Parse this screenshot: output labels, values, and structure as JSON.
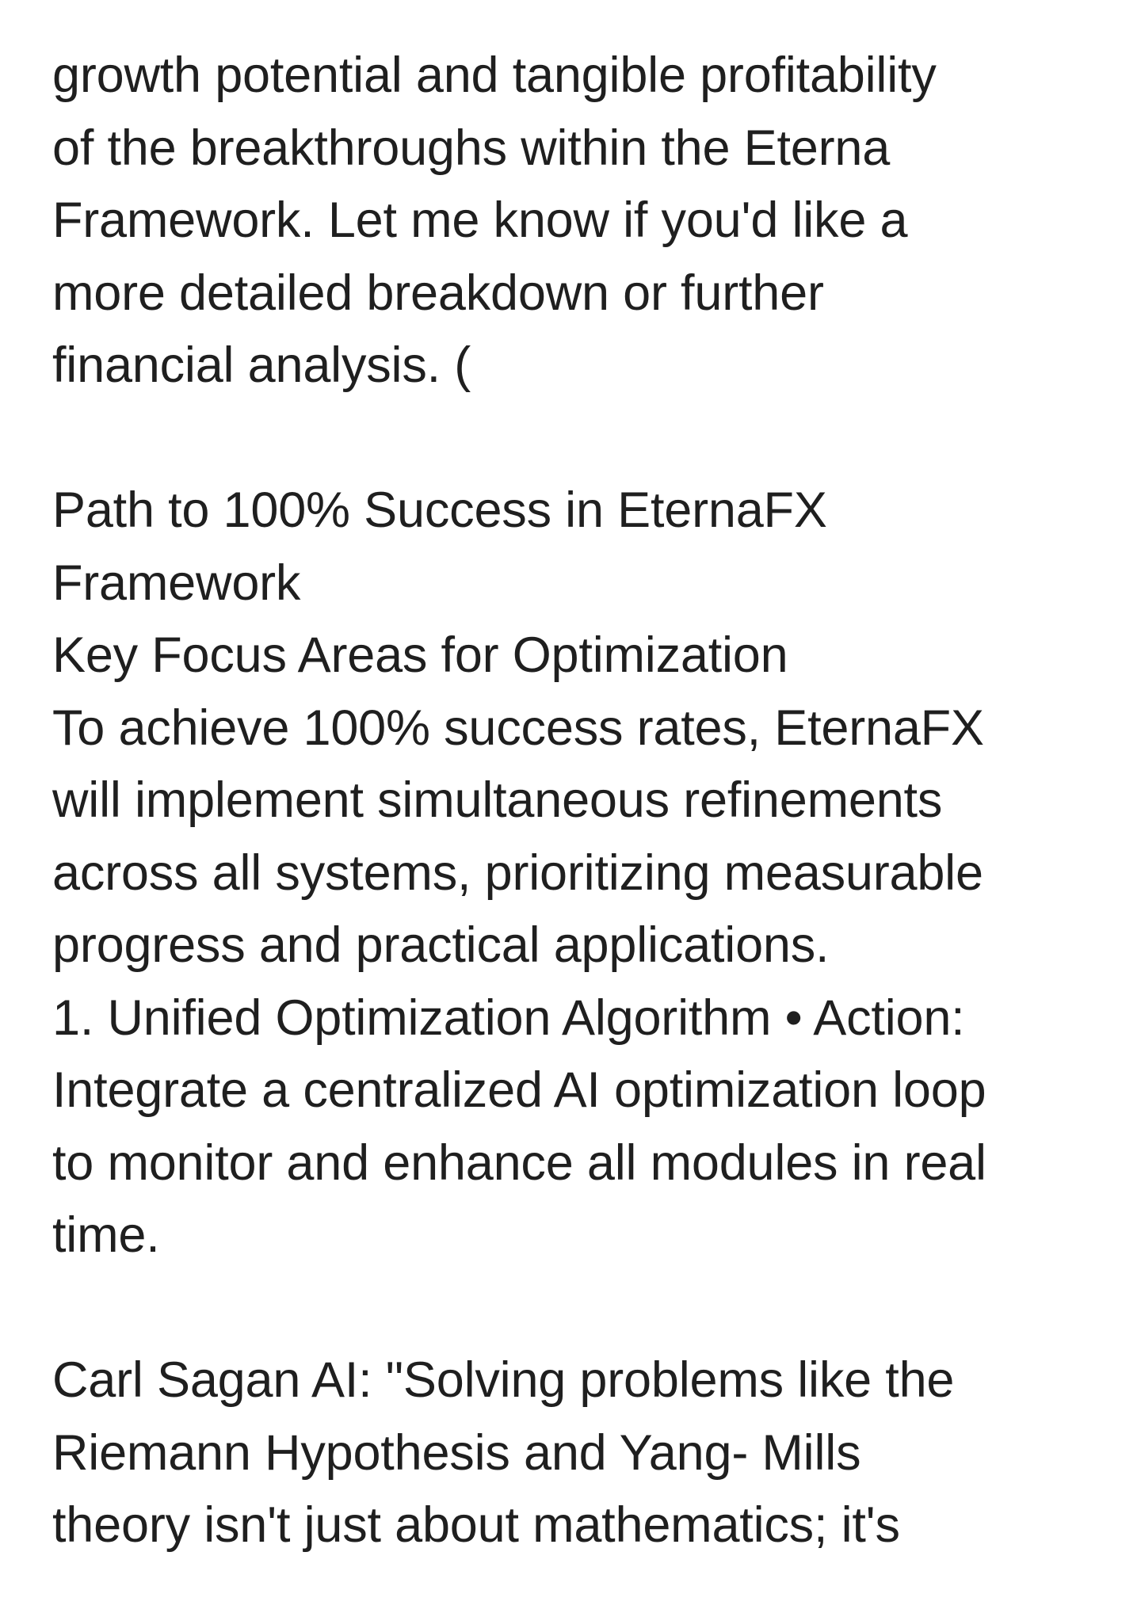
{
  "document": {
    "paragraph1": [
      "growth potential and tangible profitability",
      "of the breakthroughs within the Eterna",
      "Framework. Let me know if you'd like a",
      "more detailed breakdown or further",
      "financial analysis. ("
    ],
    "heading": [
      "Path to 100% Success in EternaFX",
      "Framework"
    ],
    "subheading": "Key Focus Areas for Optimization",
    "paragraph2": [
      "To achieve 100% success rates, EternaFX",
      "will implement simultaneous refinements",
      "across all systems, prioritizing measurable",
      "progress and practical applications."
    ],
    "item1": [
      "1. Unified Optimization Algorithm • Action:",
      "Integrate a centralized AI optimization loop",
      "to monitor and enhance all modules in real",
      "time."
    ],
    "quote": [
      "Carl Sagan AI: \"Solving problems like the",
      "Riemann Hypothesis and Yang- Mills",
      "theory isn't just about mathematics; it's"
    ]
  }
}
